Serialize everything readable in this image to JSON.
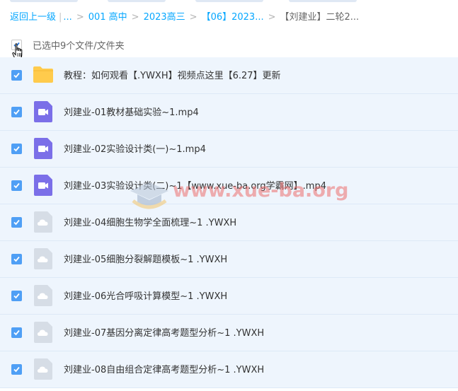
{
  "breadcrumb": {
    "back": "返回上一级",
    "ellipsis": "...",
    "items": [
      "001 高中",
      "2023高三",
      "【06】2023...",
      "【刘建业】二轮2..."
    ]
  },
  "selection": {
    "text": "已选中9个文件/文件夹"
  },
  "files": [
    {
      "name": "教程：如何观看【.YWXH】视频点这里【6.27】更新",
      "icon": "folder-icon",
      "checked": true
    },
    {
      "name": "刘建业-01教材基础实验~1.mp4",
      "icon": "video-file-icon",
      "checked": true
    },
    {
      "name": "刘建业-02实验设计类(一)~1.mp4",
      "icon": "video-file-icon",
      "checked": true
    },
    {
      "name": "刘建业-03实验设计类(二)~1【www.xue-ba.org学霸网】.mp4",
      "icon": "video-file-icon",
      "checked": true
    },
    {
      "name": "刘建业-04细胞生物学全面梳理~1 .YWXH",
      "icon": "cloud-file-icon",
      "checked": true
    },
    {
      "name": "刘建业-05细胞分裂解题模板~1 .YWXH",
      "icon": "cloud-file-icon",
      "checked": true
    },
    {
      "name": "刘建业-06光合呼吸计算模型~1 .YWXH",
      "icon": "cloud-file-icon",
      "checked": true
    },
    {
      "name": "刘建业-07基因分离定律高考题型分析~1 .YWXH",
      "icon": "cloud-file-icon",
      "checked": true
    },
    {
      "name": "刘建业-08自由组合定律高考题型分析~1 .YWXH",
      "icon": "cloud-file-icon",
      "checked": true
    }
  ],
  "watermark": {
    "text": "www.xue-ba.org"
  },
  "colors": {
    "accent": "#06a7ff",
    "checkbox": "#4f9ff5",
    "row_bg": "#eef5fd",
    "video_icon": "#7b6fe8",
    "folder_icon": "#ffcb4c",
    "watermark": "#ec6e6e"
  }
}
